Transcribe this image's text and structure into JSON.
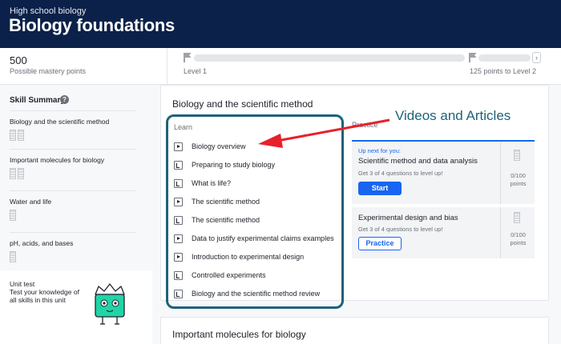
{
  "header": {
    "breadcrumb": "High school biology",
    "title": "Biology foundations",
    "colors": {
      "background": "#0b2149"
    }
  },
  "mastery": {
    "points": "500",
    "points_label": "Possible mastery points",
    "level1": "Level 1",
    "level2": "125 points to Level 2"
  },
  "sidebar": {
    "heading": "Skill Summary",
    "skills": [
      {
        "label": "Biology and the scientific method",
        "bars": 2
      },
      {
        "label": "Important molecules for biology",
        "bars": 2
      },
      {
        "label": "Water and life",
        "bars": 1
      },
      {
        "label": "pH, acids, and bases",
        "bars": 1
      }
    ],
    "unit_test": {
      "title": "Unit test",
      "description": "Test your knowledge of all skills in this unit"
    }
  },
  "main": {
    "unit_title": "Biology and the scientific method",
    "learn_label": "Learn",
    "lessons": [
      {
        "type": "video",
        "title": "Biology overview"
      },
      {
        "type": "article",
        "title": "Preparing to study biology"
      },
      {
        "type": "article",
        "title": "What is life?"
      },
      {
        "type": "video",
        "title": "The scientific method"
      },
      {
        "type": "article",
        "title": "The scientific method"
      },
      {
        "type": "video",
        "title": "Data to justify experimental claims examples"
      },
      {
        "type": "video",
        "title": "Introduction to experimental design"
      },
      {
        "type": "article",
        "title": "Controlled experiments"
      },
      {
        "type": "article",
        "title": "Biology and the scientific method review"
      }
    ],
    "practice_label": "Practice",
    "practice_cards": [
      {
        "upnext": "Up next for you:",
        "title": "Scientific method and data analysis",
        "subtitle": "Get 3 of 4 questions to level up!",
        "button": "Start",
        "points": "0/100",
        "points_unit": "points"
      },
      {
        "title": "Experimental design and bias",
        "subtitle": "Get 3 of 4 questions to level up!",
        "button": "Practice",
        "points": "0/100",
        "points_unit": "points"
      }
    ],
    "next_unit_title": "Important molecules for biology"
  },
  "annotation": {
    "text": "Videos and Articles",
    "colors": {
      "text": "#1d6378",
      "arrow": "#e8202a",
      "box": "#1d6378"
    }
  },
  "icons": {
    "lesson_video": "play-icon",
    "lesson_article": "article-icon",
    "help": "question-circle-icon",
    "flag": "flag-icon",
    "nav": "chevron-right-icon"
  }
}
